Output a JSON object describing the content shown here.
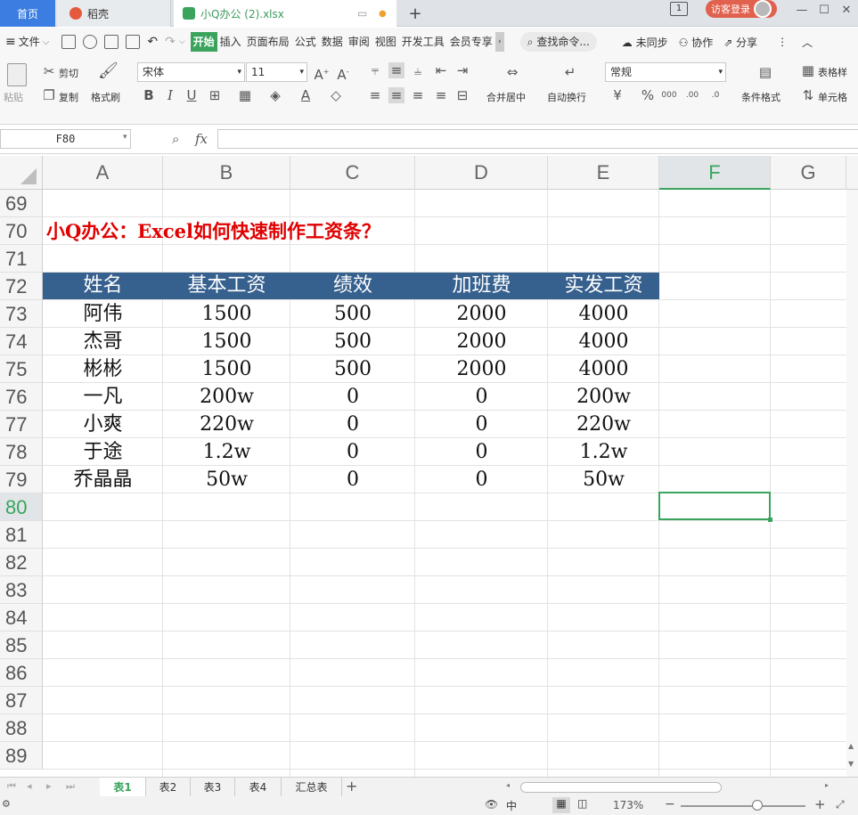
{
  "tabs": {
    "home": "首页",
    "wps": "稻壳",
    "file": "小Q办公 (2).xlsx",
    "plus": "+"
  },
  "window": {
    "login": "访客登录",
    "page_indicator": "1"
  },
  "menu": {
    "file": "文件",
    "items": [
      "开始",
      "插入",
      "页面布局",
      "公式",
      "数据",
      "审阅",
      "视图",
      "开发工具",
      "会员专享"
    ],
    "search": "查找命令...",
    "sync": "未同步",
    "collab": "协作",
    "share": "分享"
  },
  "ribbon": {
    "paste": "粘贴",
    "cut": "剪切",
    "copy": "复制",
    "format_painter": "格式刷",
    "font_name": "宋体",
    "font_size": "11",
    "merge_center": "合并居中",
    "wrap_text": "自动换行",
    "number_format": "常规",
    "conditional_format": "条件格式",
    "table_style": "表格样",
    "cell": "单元格"
  },
  "formula_bar": {
    "name_box": "F80",
    "fx": "fx",
    "formula": ""
  },
  "columns": [
    "A",
    "B",
    "C",
    "D",
    "E",
    "F",
    "G"
  ],
  "rows": [
    "69",
    "70",
    "71",
    "72",
    "73",
    "74",
    "75",
    "76",
    "77",
    "78",
    "79",
    "80",
    "81",
    "82",
    "83",
    "84",
    "85",
    "86",
    "87",
    "88",
    "89"
  ],
  "sheet": {
    "title": "小Q办公：Excel如何快速制作工资条？",
    "headers": [
      "姓名",
      "基本工资",
      "绩效",
      "加班费",
      "实发工资"
    ],
    "data": [
      [
        "阿伟",
        "1500",
        "500",
        "2000",
        "4000"
      ],
      [
        "杰哥",
        "1500",
        "500",
        "2000",
        "4000"
      ],
      [
        "彬彬",
        "1500",
        "500",
        "2000",
        "4000"
      ],
      [
        "一凡",
        "200w",
        "0",
        "0",
        "200w"
      ],
      [
        "小爽",
        "220w",
        "0",
        "0",
        "220w"
      ],
      [
        "于途",
        "1.2w",
        "0",
        "0",
        "1.2w"
      ],
      [
        "乔晶晶",
        "50w",
        "0",
        "0",
        "50w"
      ]
    ]
  },
  "sheet_tabs": [
    "表1",
    "表2",
    "表3",
    "表4",
    "汇总表"
  ],
  "status": {
    "zoom": "173%",
    "input_mode": "中"
  },
  "colors": {
    "accent": "#3aa45d",
    "header_band": "#36608e",
    "title": "#e00000",
    "home_tab": "#3b7de0"
  }
}
